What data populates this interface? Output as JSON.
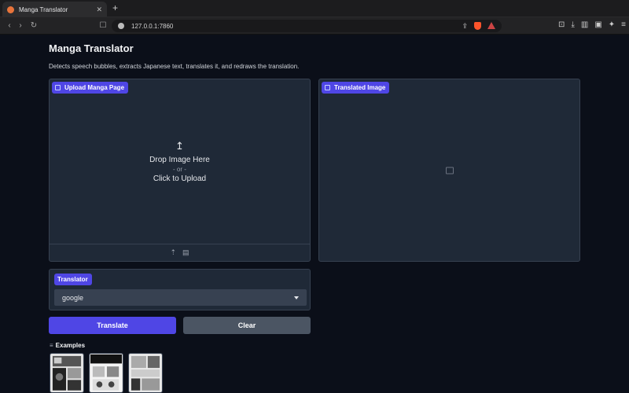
{
  "browser": {
    "tab_title": "Manga Translator",
    "tab_close": "✕",
    "new_tab": "+",
    "url": "127.0.0.1:7860"
  },
  "app": {
    "title": "Manga Translator",
    "description": "Detects speech bubbles, extracts Japanese text, translates it, and redraws the translation."
  },
  "upload_panel": {
    "label": "Upload Manga Page",
    "upload_icon": "↥",
    "drop_text": "Drop Image Here",
    "or_text": "- or -",
    "click_text": "Click to Upload"
  },
  "output_panel": {
    "label": "Translated Image"
  },
  "translator": {
    "label": "Translator",
    "selected": "google"
  },
  "buttons": {
    "translate": "Translate",
    "clear": "Clear"
  },
  "examples": {
    "header": "Examples",
    "list_icon": "≡"
  },
  "icons": {
    "back": "‹",
    "forward": "›",
    "reload": "↻",
    "bookmark": "☐",
    "share": "⇪",
    "download": "⤓",
    "sidebar": "▥",
    "wallet": "▣",
    "leo": "✦",
    "menu": "≡",
    "upload_small": "⇡",
    "clipboard": "▤"
  },
  "colors": {
    "accent": "#4f46e5",
    "panel": "#1f2937",
    "background": "#0b0f19",
    "secondary_button": "#4b5563"
  }
}
